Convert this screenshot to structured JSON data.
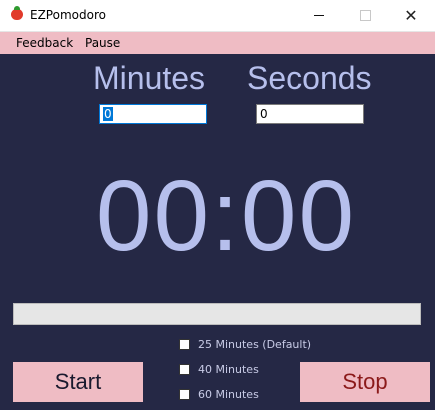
{
  "window": {
    "title": "EZPomodoro",
    "close_glyph": "✕"
  },
  "menu": {
    "items": [
      "Feedback",
      "Pause"
    ]
  },
  "inputs": {
    "minutes_label": "Minutes",
    "seconds_label": "Seconds",
    "minutes_value": "0",
    "seconds_value": "0"
  },
  "timer": {
    "display": "00:00"
  },
  "progress": {
    "fraction": 0
  },
  "options": [
    {
      "label": "25 Minutes (Default)",
      "checked": false
    },
    {
      "label": "40 Minutes",
      "checked": false
    },
    {
      "label": "60 Minutes",
      "checked": false
    }
  ],
  "buttons": {
    "start": "Start",
    "stop": "Stop"
  },
  "colors": {
    "background": "#252845",
    "accent_pink": "#efbcc4",
    "text_lavender": "#b6bfec"
  }
}
